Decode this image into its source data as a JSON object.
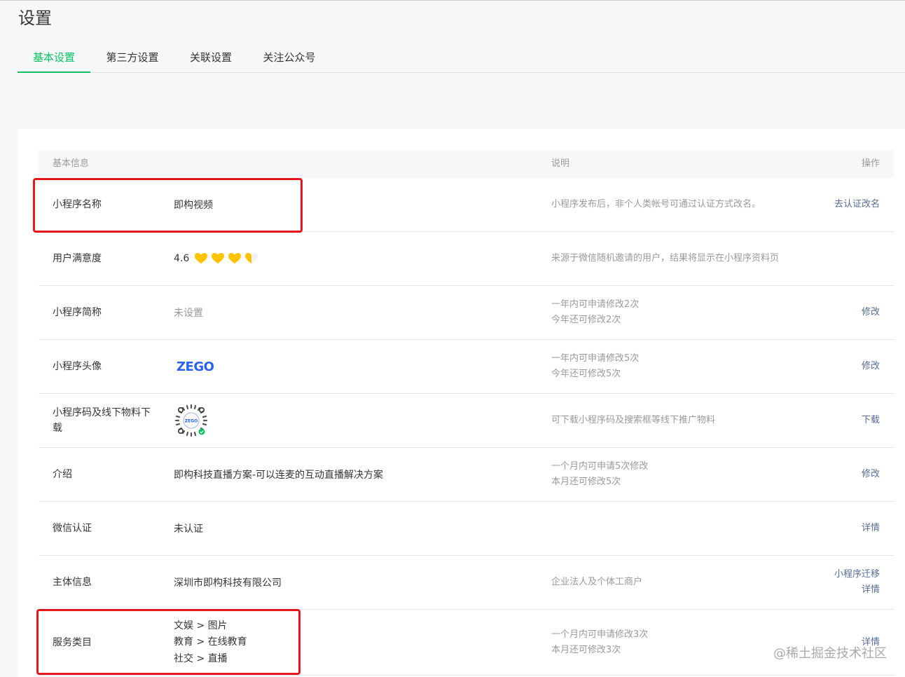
{
  "page": {
    "title": "设置"
  },
  "tabs": [
    {
      "label": "基本设置",
      "active": true
    },
    {
      "label": "第三方设置",
      "active": false
    },
    {
      "label": "关联设置",
      "active": false
    },
    {
      "label": "关注公众号",
      "active": false
    }
  ],
  "table": {
    "headers": {
      "info": "基本信息",
      "desc": "说明",
      "op": "操作"
    },
    "rows": {
      "name": {
        "label": "小程序名称",
        "value": "即构视频",
        "desc": "小程序发布后，非个人类帐号可通过认证方式改名。",
        "op": "去认证改名"
      },
      "rating": {
        "label": "用户满意度",
        "value": "4.6",
        "desc": "来源于微信随机邀请的用户，结果将显示在小程序资料页",
        "stars": 3.5
      },
      "short_name": {
        "label": "小程序简称",
        "value": "未设置",
        "desc1": "一年内可申请修改2次",
        "desc2": "今年还可修改2次",
        "op": "修改"
      },
      "avatar": {
        "label": "小程序头像",
        "logo_text": "ZEGO",
        "desc1": "一年内可申请修改5次",
        "desc2": "今年还可修改5次",
        "op": "修改"
      },
      "qrcode": {
        "label": "小程序码及线下物料下载",
        "qr_text": "ZEGO",
        "desc": "可下载小程序码及搜索框等线下推广物料",
        "op": "下载"
      },
      "intro": {
        "label": "介绍",
        "value": "即构科技直播方案-可以连麦的互动直播解决方案",
        "desc1": "一个月内可申请5次修改",
        "desc2": "本月还可修改5次",
        "op": "修改"
      },
      "verify": {
        "label": "微信认证",
        "value": "未认证",
        "op": "详情"
      },
      "entity": {
        "label": "主体信息",
        "value": "深圳市即构科技有限公司",
        "desc": "企业法人及个体工商户",
        "op1": "小程序迁移",
        "op2": "详情"
      },
      "category": {
        "label": "服务类目",
        "values": [
          "文娱 > 图片",
          "教育 > 在线教育",
          "社交 > 直播"
        ],
        "desc1": "一个月内可申请修改3次",
        "desc2": "本月还可修改3次",
        "op": "详情"
      }
    }
  },
  "watermark": "@稀土掘金技术社区",
  "colors": {
    "accent": "#07c160",
    "link": "#576b95",
    "highlight": "#e5161c",
    "star": "#ffc300"
  }
}
